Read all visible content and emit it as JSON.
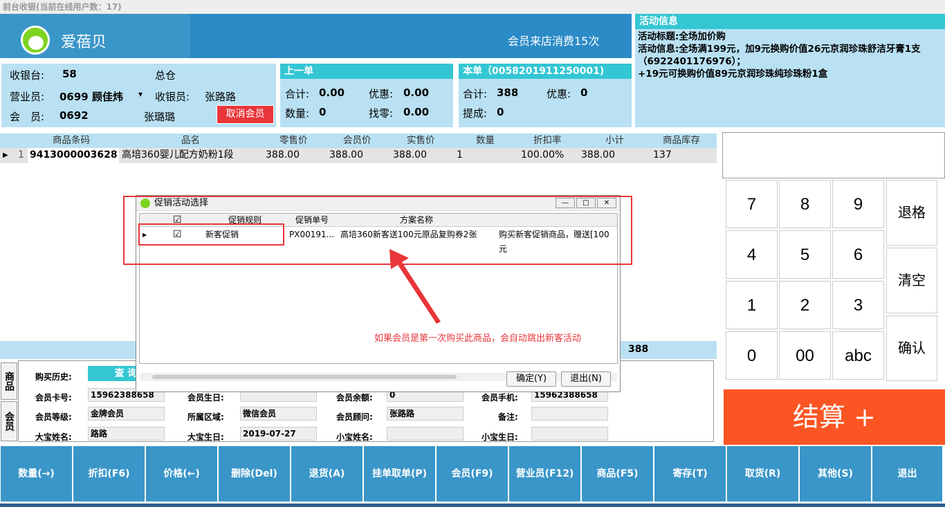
{
  "window": {
    "title": "前台收银(当前在线用户数：17)"
  },
  "header": {
    "brand": "爱蓓贝",
    "visits": "会员来店消费15次"
  },
  "activity": {
    "heading": "活动信息",
    "title_line": "活动标题:全场加价购",
    "info_line": "活动信息:全场满199元，加9元换购价值26元京润珍珠舒洁牙膏1支（6922401176976）；",
    "extra_line": "+19元可换购价值89元京润珍珠纯珍珠粉1盒"
  },
  "info": {
    "cashier_label": "收银台:",
    "cashier_value": "58",
    "warehouse": "总仓",
    "sales_label": "营业员:",
    "sales_value": "0699 顾佳炜",
    "sales_dropdown": "▾",
    "cashier_person_label": "收银员:",
    "cashier_person": "张路路",
    "member_label": "会　员:",
    "member_id": "0692",
    "member_name": "张璐璐",
    "cancel_member": "取消会员"
  },
  "last_order": {
    "heading": "上一单",
    "total_label": "合计:",
    "total": "0.00",
    "discount_label": "优惠:",
    "discount": "0.00",
    "qty_label": "数量:",
    "qty": "0",
    "change_label": "找零:",
    "change": "0.00"
  },
  "current_order": {
    "heading": "本单（0058201911250001)",
    "total_label": "合计:",
    "total": "388",
    "discount_label": "优惠:",
    "discount": "0",
    "commission_label": "提成:",
    "commission": "0"
  },
  "grid": {
    "columns": [
      "商品条码",
      "品名",
      "零售价",
      "会员价",
      "实售价",
      "数量",
      "折扣率",
      "小计",
      "商品库存"
    ],
    "rows": [
      {
        "index": "1",
        "barcode": "9413000003628",
        "name": "高培360婴儿配方奶粉1段",
        "retail": "388.00",
        "member": "388.00",
        "actual": "388.00",
        "qty": "1",
        "rate": "100.00%",
        "subtotal": "388.00",
        "stock": "137"
      }
    ]
  },
  "summary": {
    "total": "388"
  },
  "keypad": {
    "keys": [
      "7",
      "8",
      "9",
      "4",
      "5",
      "6",
      "1",
      "2",
      "3",
      "0",
      "00",
      "abc"
    ],
    "backspace": "退格",
    "clear": "清空",
    "confirm": "确认"
  },
  "checkout": {
    "label": "结算 +"
  },
  "member_detail": {
    "tab_goods": "商品",
    "tab_member": "会员",
    "history_label": "购买历史:",
    "query_btn": "查 询",
    "card_label": "会员卡号:",
    "card_value": "15962388658",
    "birthday_label": "会员生日:",
    "balance_label": "会员余额:",
    "balance_value": "0",
    "phone_label": "会员手机:",
    "phone_value": "15962388658",
    "level_label": "会员等级:",
    "level_value": "金牌会员",
    "region_label": "所属区域:",
    "region_value": "微信会员",
    "advisor_label": "会员顾问:",
    "advisor_value": "张路路",
    "note_label": "备注:",
    "baby1_name_label": "大宝姓名:",
    "baby1_name": "路路",
    "baby1_bday_label": "大宝生日:",
    "baby1_bday": "2019-07-27",
    "baby2_name_label": "小宝姓名:",
    "baby2_bday_label": "小宝生日:"
  },
  "dialog": {
    "title": "促销活动选择",
    "columns": [
      "促销规则",
      "促销单号",
      "方案名称"
    ],
    "row": {
      "rule": "新客促销",
      "code": "PX00191...",
      "plan": "高培360新客送100元原品复购券2张",
      "desc": "购买新客促销商品，赠送[100元"
    },
    "ok": "确定(Y)",
    "cancel": "退出(N)",
    "check_mark": "☑",
    "minimize": "—",
    "maximize": "□",
    "close": "✕"
  },
  "annotation": {
    "text": "如果会员是第一次购买此商品，会自动跳出新客活动"
  },
  "function_bar": [
    "数量(→)",
    "折扣(F6)",
    "价格(←)",
    "删除(Del)",
    "退货(A)",
    "挂单取单(P)",
    "会员(F9)",
    "营业员(F12)",
    "商品(F5)",
    "寄存(T)",
    "取货(R)",
    "其他(S)",
    "退出"
  ]
}
